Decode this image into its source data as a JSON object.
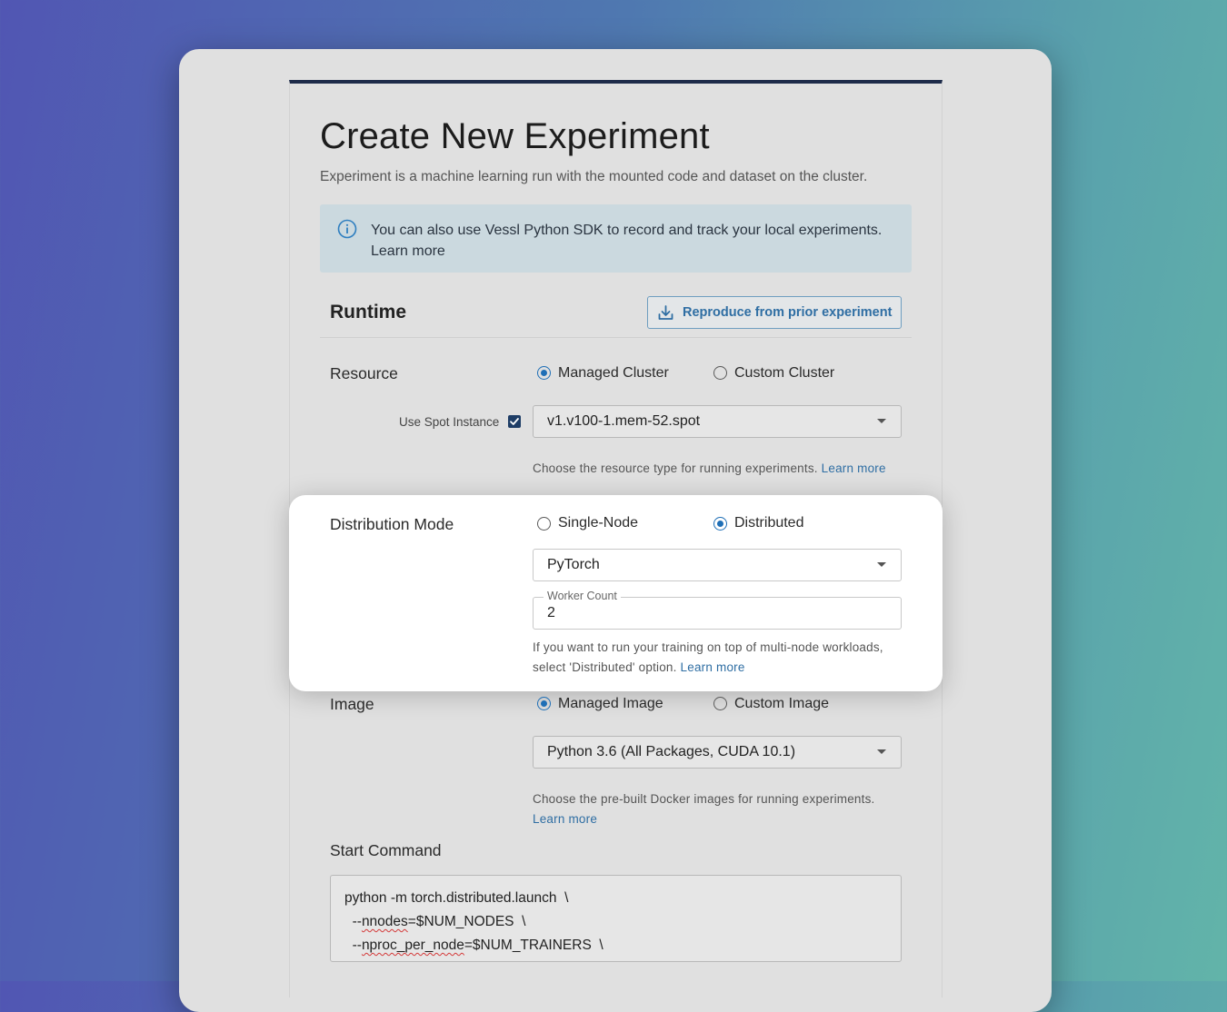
{
  "page": {
    "title": "Create New Experiment",
    "subtitle": "Experiment is a machine learning run with the mounted code and dataset on the cluster."
  },
  "info": {
    "icon": "info-icon",
    "text": "You can also use Vessl Python SDK to record and track your local experiments.",
    "link": "Learn more"
  },
  "runtime": {
    "title": "Runtime",
    "reproduce_button": "Reproduce from prior experiment",
    "reproduce_icon": "download-icon"
  },
  "resource": {
    "label": "Resource",
    "options": [
      {
        "label": "Managed Cluster",
        "selected": true
      },
      {
        "label": "Custom Cluster",
        "selected": false
      }
    ],
    "spot_label": "Use Spot Instance",
    "spot_checked": true,
    "selected": "v1.v100-1.mem-52.spot",
    "helper": "Choose the resource type for running experiments.",
    "helper_link": "Learn more"
  },
  "distribution": {
    "label": "Distribution Mode",
    "options": [
      {
        "label": "Single-Node",
        "selected": false
      },
      {
        "label": "Distributed",
        "selected": true
      }
    ],
    "framework": "PyTorch",
    "worker_count_label": "Worker Count",
    "worker_count": "2",
    "helper_line1": "If you want to run your training on top of multi-node workloads,",
    "helper_line2": "select 'Distributed' option.",
    "helper_link": "Learn more"
  },
  "image": {
    "label": "Image",
    "options": [
      {
        "label": "Managed Image",
        "selected": true
      },
      {
        "label": "Custom Image",
        "selected": false
      }
    ],
    "selected": "Python 3.6 (All Packages, CUDA 10.1)",
    "helper": "Choose the pre-built Docker images for running experiments.",
    "helper_link": "Learn more"
  },
  "start_command": {
    "label": "Start Command",
    "lines": [
      {
        "pre": "python -m torch.distributed.launch  \\",
        "squiggle": "",
        "post": ""
      },
      {
        "pre": "  --",
        "squiggle": "nnodes",
        "post": "=$NUM_NODES  \\"
      },
      {
        "pre": "  --",
        "squiggle": "nproc_per_node",
        "post": "=$NUM_TRAINERS  \\"
      }
    ]
  },
  "colors": {
    "accent": "#1f6fb6",
    "link": "#2f6ea3",
    "header_bar": "#1e2c4a",
    "info_bg": "#cbd9df"
  }
}
